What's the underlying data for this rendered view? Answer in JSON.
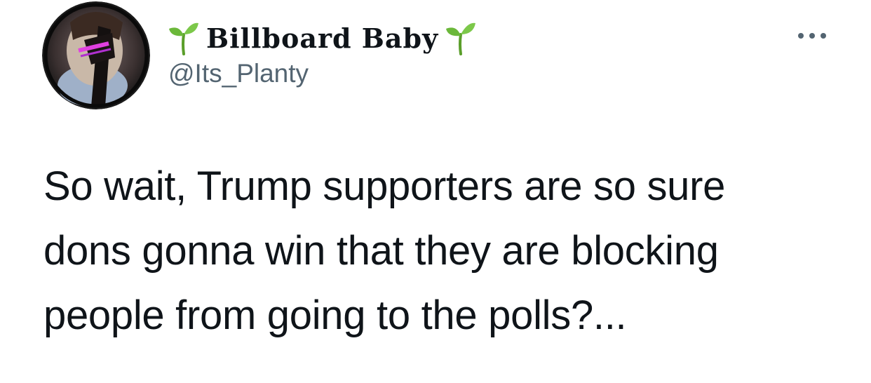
{
  "author": {
    "display_name": "Billboard Baby",
    "handle": "@Its_Planty",
    "name_decoration_icon": "seedling-icon",
    "avatar_icon": "profile-avatar"
  },
  "actions": {
    "more_icon": "more-horizontal-icon"
  },
  "tweet": {
    "lines": [
      "So wait, Trump supporters are so sure",
      "dons gonna win that they are blocking",
      "people from going to the polls?..."
    ]
  },
  "colors": {
    "text_primary": "#0f1419",
    "text_secondary": "#536471",
    "sprout_green": "#6bb83a",
    "background": "#ffffff"
  }
}
